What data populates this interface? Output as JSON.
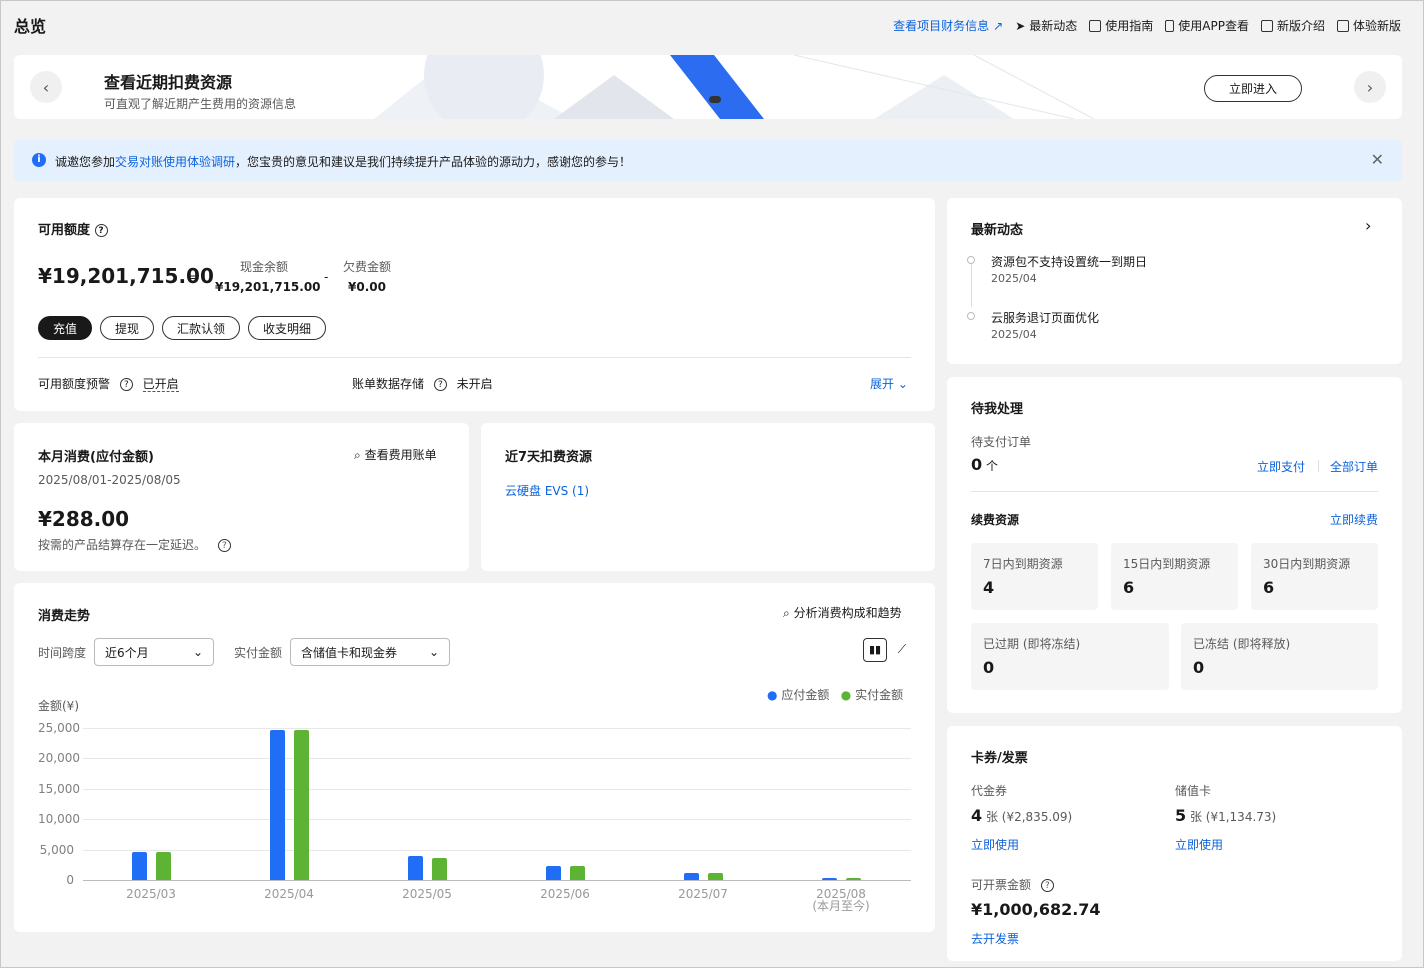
{
  "page_title": "总览",
  "top_links": {
    "finance": "查看项目财务信息",
    "news": "最新动态",
    "guide": "使用指南",
    "app": "使用APP查看",
    "intro": "新版介绍",
    "try": "体验新版"
  },
  "banner": {
    "title": "查看近期扣费资源",
    "subtitle": "可直观了解近期产生费用的资源信息",
    "cta": "立即进入"
  },
  "notice": {
    "prefix": "诚邀您参加",
    "link": "交易对账使用体验调研",
    "suffix": "，您宝贵的意见和建议是我们持续提升产品体验的源动力，感谢您的参与！"
  },
  "quota": {
    "title": "可用额度",
    "total": "¥19,201,715.00",
    "eq": "=",
    "cash_label": "现金余额",
    "cash": "¥19,201,715.00",
    "minus": "-",
    "debt_label": "欠费金额",
    "debt": "¥0.00",
    "actions": [
      "充值",
      "提现",
      "汇款认领",
      "收支明细"
    ],
    "alert_label": "可用额度预警",
    "alert_value": "已开启",
    "storage_label": "账单数据存储",
    "storage_value": "未开启",
    "expand": "展开"
  },
  "month": {
    "title": "本月消费(应付金额)",
    "view_bill": "查看费用账单",
    "range": "2025/08/01-2025/08/05",
    "amount": "¥288.00",
    "note": "按需的产品结算存在一定延迟。"
  },
  "recent7": {
    "title": "近7天扣费资源",
    "item": "云硬盘 EVS (1)"
  },
  "trend": {
    "title": "消费走势",
    "analyze": "分析消费构成和趋势",
    "span_label": "时间跨度",
    "span_value": "近6个月",
    "paid_label": "实付金额",
    "paid_value": "含储值卡和现金券",
    "ylabel": "金额(¥)",
    "legend_due": "应付金额",
    "legend_paid": "实付金额"
  },
  "chart_data": {
    "type": "bar",
    "categories": [
      "2025/03",
      "2025/04",
      "2025/05",
      "2025/06",
      "2025/07",
      "2025/08"
    ],
    "category_sublabels": [
      "",
      "",
      "",
      "",
      "",
      "(本月至今)"
    ],
    "ylabel": "金额(¥)",
    "ylim": [
      0,
      25000
    ],
    "yticks": [
      "25,000",
      "20,000",
      "15,000",
      "10,000",
      "5,000",
      "0"
    ],
    "legend_position": "top-right",
    "series": [
      {
        "name": "应付金额",
        "color": "#1f6ef5",
        "values": [
          4600,
          24600,
          3900,
          2300,
          1200,
          288
        ]
      },
      {
        "name": "实付金额",
        "color": "#5db434",
        "values": [
          4600,
          24600,
          3600,
          2300,
          1100,
          288
        ]
      }
    ]
  },
  "news": {
    "title": "最新动态",
    "items": [
      {
        "text": "资源包不支持设置统一到期日",
        "date": "2025/04"
      },
      {
        "text": "云服务退订页面优化",
        "date": "2025/04"
      }
    ]
  },
  "todo": {
    "title": "待我处理",
    "pending_label": "待支付订单",
    "pending_count": "0",
    "pending_unit": "个",
    "pay_now": "立即支付",
    "all_orders": "全部订单",
    "renew_title": "续费资源",
    "renew_now": "立即续费",
    "boxes": [
      {
        "t": "7日内到期资源",
        "n": "4"
      },
      {
        "t": "15日内到期资源",
        "n": "6"
      },
      {
        "t": "30日内到期资源",
        "n": "6"
      },
      {
        "t": "已过期 (即将冻结)",
        "n": "0"
      },
      {
        "t": "已冻结 (即将释放)",
        "n": "0"
      }
    ]
  },
  "cards": {
    "title": "卡券/发票",
    "coupon_label": "代金券",
    "coupon_count": "4",
    "coupon_detail": "张 (¥2,835.09)",
    "coupon_use": "立即使用",
    "stored_label": "储值卡",
    "stored_count": "5",
    "stored_detail": "张 (¥1,134.73)",
    "stored_use": "立即使用",
    "invoice_label": "可开票金额",
    "invoice_amount": "¥1,000,682.74",
    "invoice_link": "去开发票"
  }
}
